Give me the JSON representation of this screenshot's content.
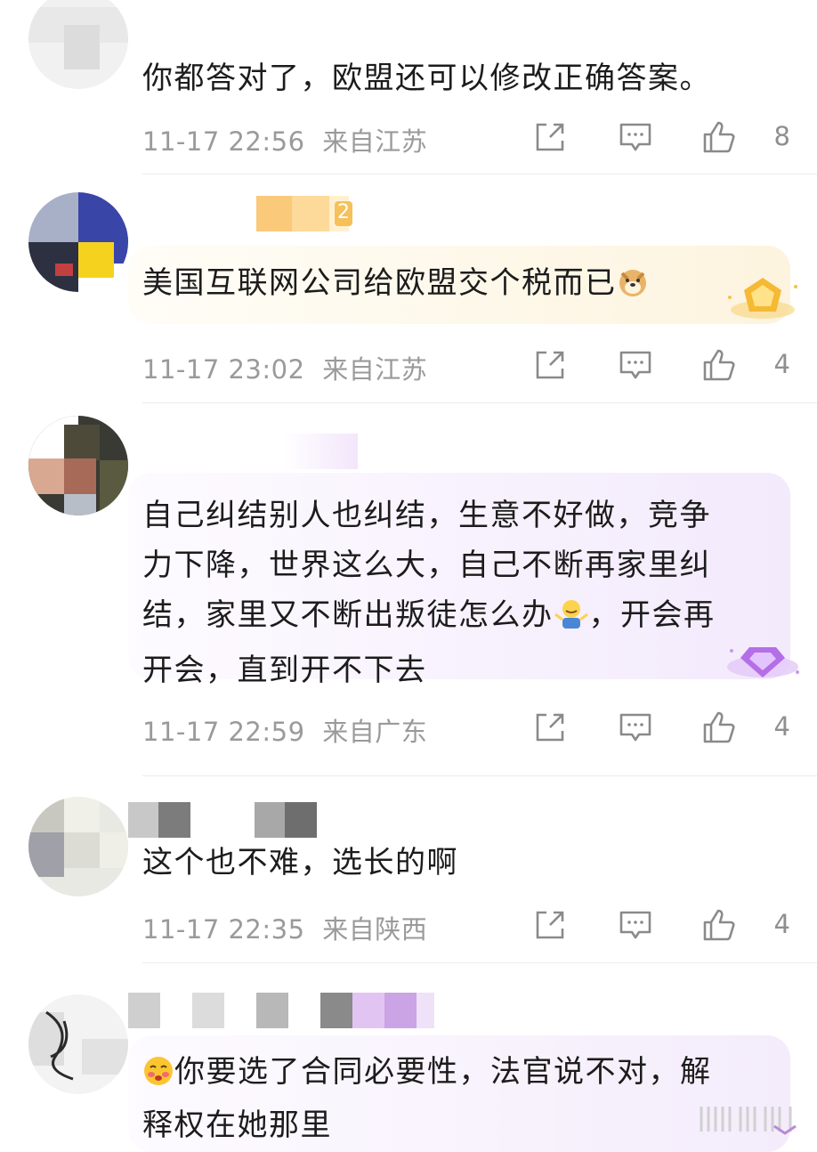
{
  "comments": [
    {
      "text": "你都答对了，欧盟还可以修改正确答案。",
      "time": "11-17 22:56",
      "location": "来自江苏",
      "likes": "8"
    },
    {
      "text": "美国互联网公司给欧盟交个税而已",
      "name_suffix": "2",
      "emoji": "doge-emoji",
      "time": "11-17 23:02",
      "location": "来自江苏",
      "likes": "4",
      "badge": "gold-crown-badge"
    },
    {
      "text_parts": [
        "自己纠结别人也纠结，生意不好做，竞争",
        "力下降，世界这么大，自己不断再家里纠",
        "结，家里又不断出叛徒怎么办",
        "，开会再",
        "开会，直到开不下去"
      ],
      "emoji": "shrug-emoji",
      "time": "11-17 22:59",
      "location": "来自广东",
      "likes": "4",
      "badge": "purple-diamond-badge"
    },
    {
      "text": "这个也不难，选长的啊",
      "time": "11-17 22:35",
      "location": "来自陕西",
      "likes": "4"
    },
    {
      "text_line1": "你要选了合同必要性，法官说不对，解",
      "text_line2": "释权在她那里",
      "emoji": "blush-emoji"
    }
  ],
  "colors": {
    "meta_gray": "#9a9a9a",
    "gold_bubble": "#fdf6e3",
    "purple_bubble": "#f6effc",
    "icon_gray": "#8a8a8a"
  }
}
